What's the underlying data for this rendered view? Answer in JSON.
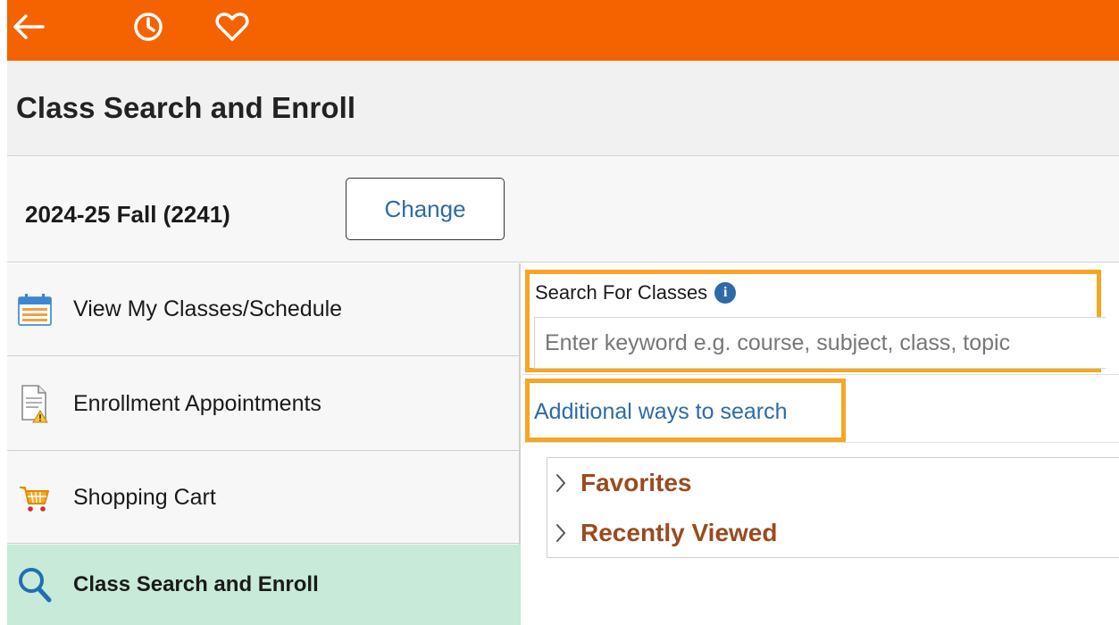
{
  "topbar": {
    "color": "#f56300",
    "icons": [
      "back-arrow-icon",
      "recent-history-icon",
      "favorites-heart-icon"
    ]
  },
  "page": {
    "title": "Class Search and Enroll"
  },
  "term": {
    "label": "2024-25 Fall (2241)",
    "change_label": "Change"
  },
  "sidebar": {
    "items": [
      {
        "label": "View My Classes/Schedule",
        "icon": "calendar-icon",
        "active": false
      },
      {
        "label": "Enrollment Appointments",
        "icon": "document-warning-icon",
        "active": false
      },
      {
        "label": "Shopping Cart",
        "icon": "shopping-cart-icon",
        "active": false
      },
      {
        "label": "Class Search and Enroll",
        "icon": "search-icon",
        "active": true
      }
    ],
    "active_color": "#c8ead8"
  },
  "search": {
    "title": "Search For Classes",
    "placeholder": "Enter keyword e.g. course, subject, class, topic",
    "additional_link": "Additional ways to search",
    "highlight_color": "#f5a623"
  },
  "accordion": {
    "items": [
      {
        "label": "Favorites"
      },
      {
        "label": "Recently Viewed"
      }
    ],
    "label_color": "#9a4a20"
  }
}
